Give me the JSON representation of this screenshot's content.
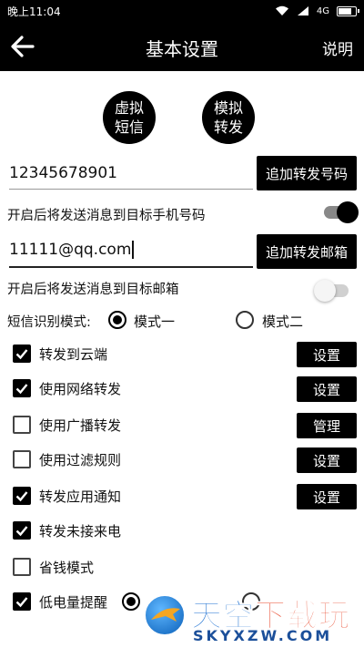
{
  "status_bar": {
    "time": "晚上11:04",
    "signal_text": "4G",
    "battery_level": 0.85
  },
  "header": {
    "title": "基本设置",
    "help_label": "说明"
  },
  "round_buttons": [
    {
      "label": "虚拟\n短信"
    },
    {
      "label": "模拟\n转发"
    }
  ],
  "phone": {
    "value": "12345678901",
    "button_label": "追加转发号码",
    "hint": "开启后将发送消息到目标手机号码",
    "enabled": true
  },
  "email": {
    "value": "11111@qq.com",
    "button_label": "追加转发邮箱",
    "hint": "开启后将发送消息到目标邮箱",
    "enabled": false
  },
  "mode": {
    "label": "短信识别模式:",
    "options": [
      "模式一",
      "模式二"
    ],
    "selected": 0
  },
  "options": [
    {
      "label": "转发到云端",
      "checked": true,
      "button": "设置"
    },
    {
      "label": "使用网络转发",
      "checked": true,
      "button": "设置"
    },
    {
      "label": "使用广播转发",
      "checked": false,
      "button": "管理"
    },
    {
      "label": "使用过滤规则",
      "checked": false,
      "button": "设置"
    },
    {
      "label": "转发应用通知",
      "checked": true,
      "button": "设置"
    },
    {
      "label": "转发未接来电",
      "checked": true
    },
    {
      "label": "省钱模式",
      "checked": false
    },
    {
      "label": "低电量提醒",
      "checked": true
    }
  ],
  "watermark": {
    "cn_part1": "天空",
    "cn_part2": "下载玩",
    "en": "SKYXZW.COM"
  },
  "colors": {
    "primary": "#000000",
    "background": "#ffffff",
    "watermark_blue": "#1b6fd1",
    "watermark_red": "#e8462a"
  }
}
